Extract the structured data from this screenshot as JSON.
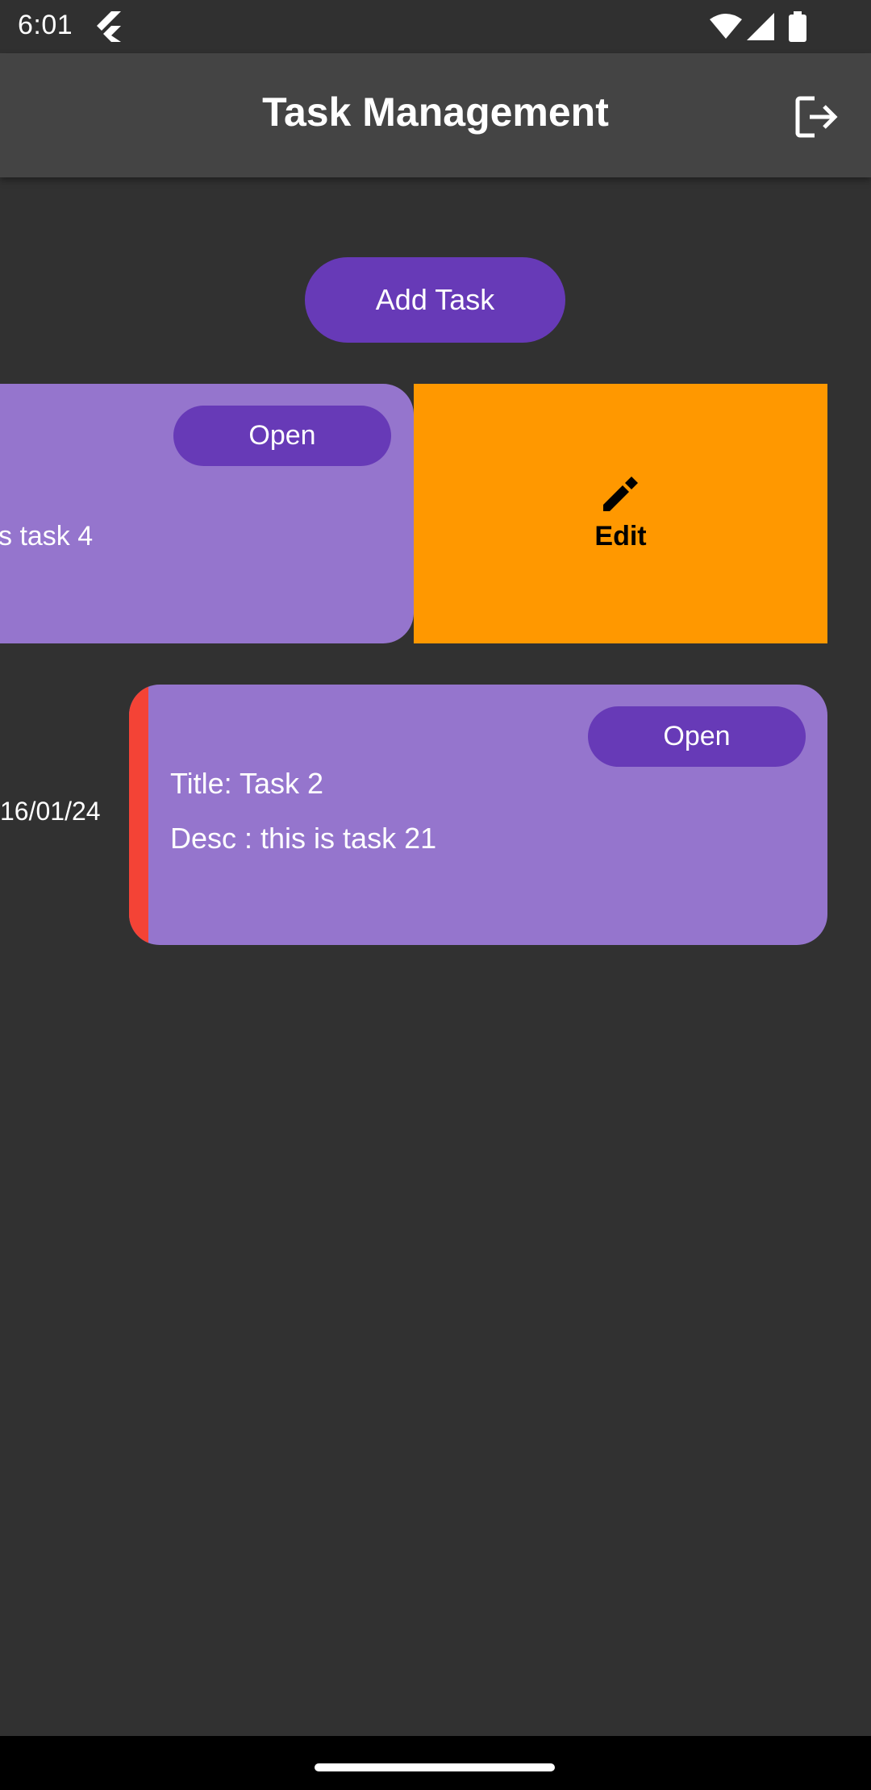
{
  "status_bar": {
    "time": "6:01",
    "icons": [
      "flutter-icon",
      "wifi-icon",
      "signal-icon",
      "battery-icon"
    ]
  },
  "app_bar": {
    "title": "Task Management",
    "action_icon": "logout-icon"
  },
  "add_task_button": {
    "label": "Add Task"
  },
  "tasks": [
    {
      "status": "Open",
      "desc_visible": "s task 4",
      "swipe_action": {
        "label": "Edit",
        "icon": "edit-icon",
        "color": "#ff9800"
      }
    },
    {
      "date": "16/01/24",
      "status": "Open",
      "title": "Title: Task 2",
      "desc": "Desc : this is task 21",
      "priority_color": "#f44336"
    }
  ],
  "colors": {
    "background": "#313131",
    "app_bar": "#444444",
    "accent": "#673ab7",
    "card": "#9575cd",
    "edit": "#ff9800",
    "priority": "#f44336"
  }
}
